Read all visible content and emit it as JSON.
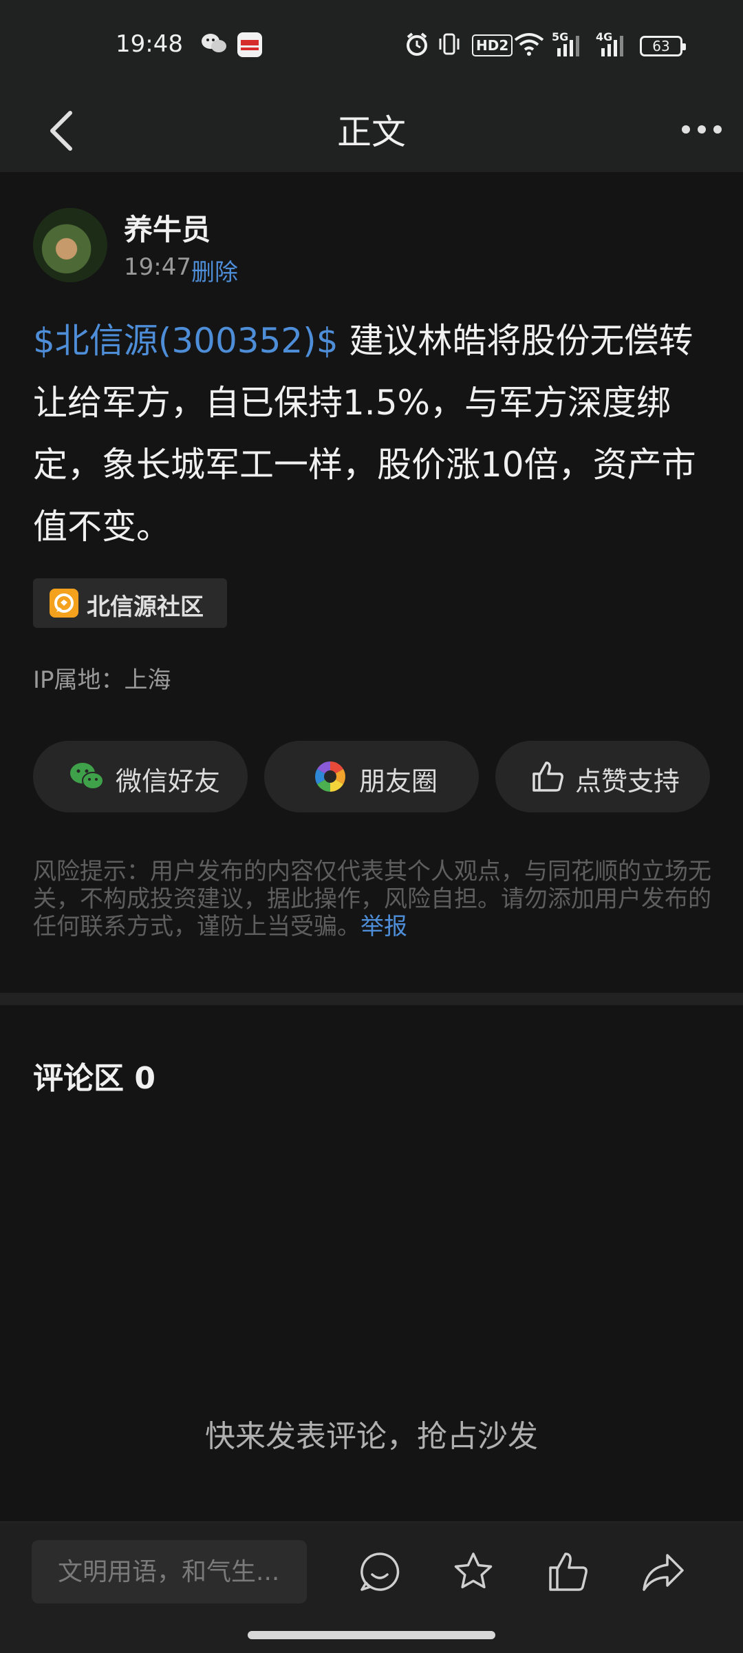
{
  "status_bar": {
    "time": "19:48",
    "battery": "63",
    "network_labels": [
      "HD2",
      "5G",
      "4G"
    ]
  },
  "header": {
    "title": "正文"
  },
  "post": {
    "author": "养牛员",
    "time": "19:47",
    "delete_label": "删除",
    "stock_link": "$北信源(300352)$",
    "body_text": " 建议林皓将股份无偿转让给军方，自已保持1.5%，与军方深度绑定，象长城军工一样，股价涨10倍，资产市值不变。",
    "community_tag": "北信源社区",
    "ip_location": "IP属地：上海"
  },
  "share_buttons": [
    {
      "label": "微信好友",
      "icon": "wechat-icon"
    },
    {
      "label": "朋友圈",
      "icon": "moments-icon"
    },
    {
      "label": "点赞支持",
      "icon": "thumbs-up-icon"
    }
  ],
  "risk_notice": {
    "text": "风险提示：用户发布的内容仅代表其个人观点，与同花顺的立场无关，不构成投资建议，据此操作，风险自担。请勿添加用户发布的任何联系方式，谨防上当受骗。",
    "report_label": "举报"
  },
  "comments": {
    "header": "评论区 0",
    "empty_message": "快来发表评论，抢占沙发"
  },
  "bottom_bar": {
    "input_placeholder": "文明用语，和气生..."
  },
  "colors": {
    "link_blue": "#4e8ed8",
    "background": "#141414",
    "bar_background": "#202121",
    "community_orange": "#f4a11d",
    "wechat_green": "#3fa24a"
  }
}
